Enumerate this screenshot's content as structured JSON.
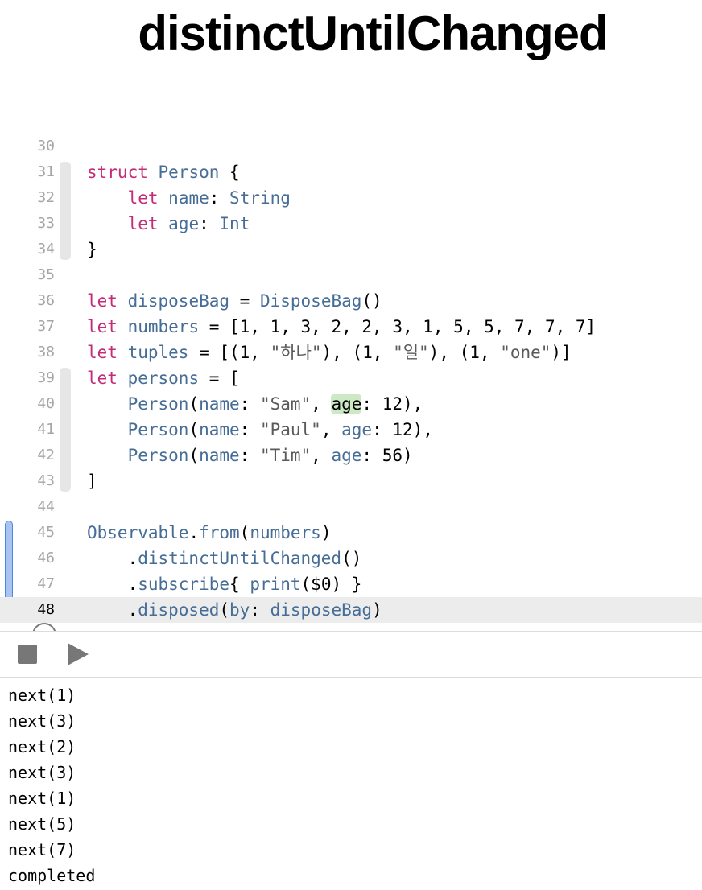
{
  "page": {
    "title": "distinctUntilChanged"
  },
  "editor": {
    "current_line": 48,
    "line_numbers": [
      "30",
      "31",
      "32",
      "33",
      "34",
      "35",
      "36",
      "37",
      "38",
      "39",
      "40",
      "41",
      "42",
      "43",
      "44",
      "45",
      "46",
      "47",
      "48"
    ]
  },
  "console": {
    "lines": [
      "next(1)",
      "next(3)",
      "next(2)",
      "next(3)",
      "next(1)",
      "next(5)",
      "next(7)",
      "completed"
    ]
  },
  "toolbar": {
    "stop_icon": "stop-icon",
    "run_icon": "play-icon"
  },
  "colors": {
    "keyword": "#c42c78",
    "type": "#466d96",
    "string": "#5a5a5a",
    "highlight": "#cde8c4",
    "current_line_bg": "#ececec",
    "change_bar": "#4e86e4"
  }
}
